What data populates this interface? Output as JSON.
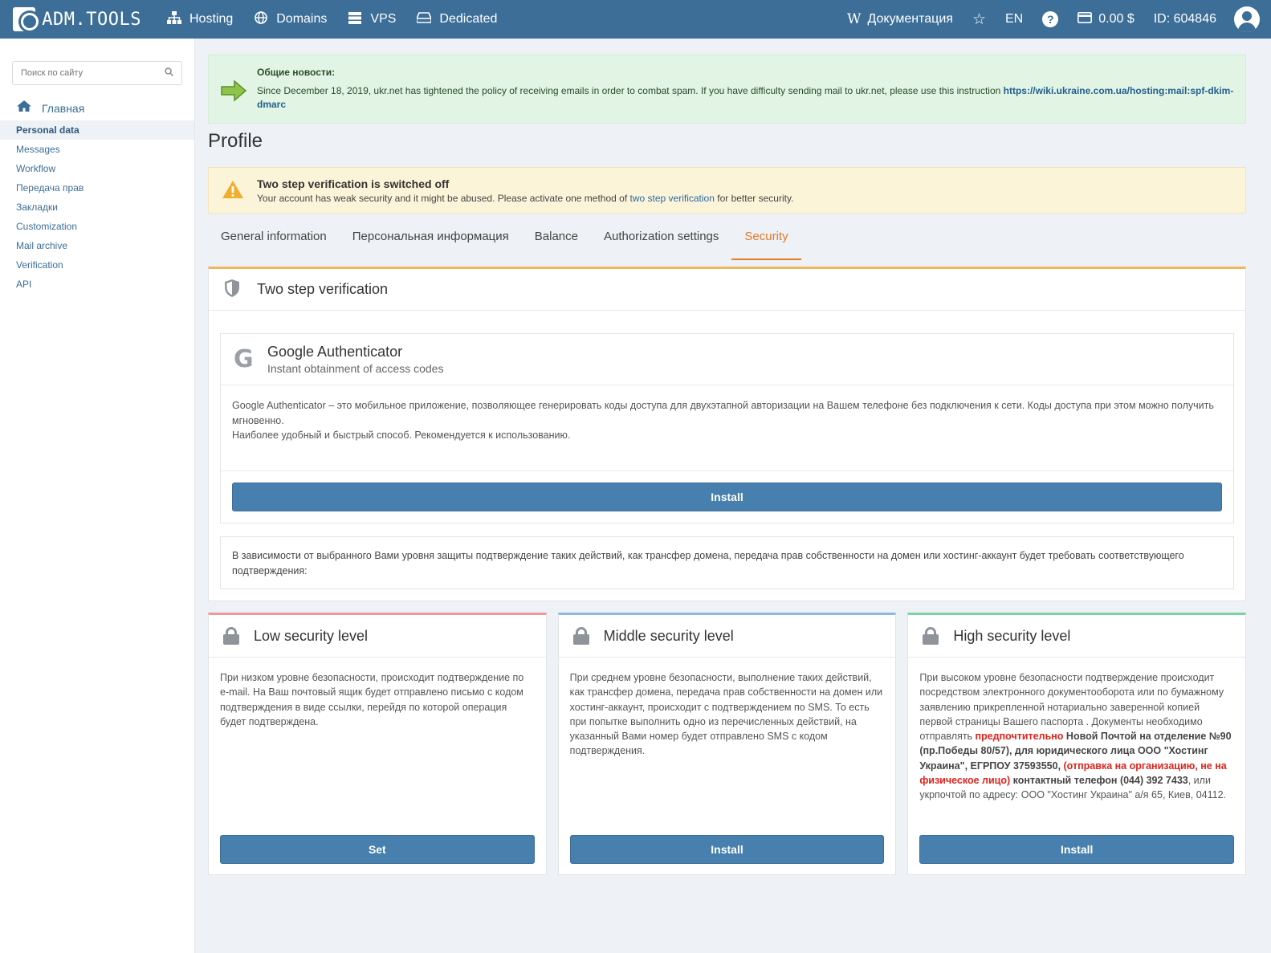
{
  "topbar": {
    "logo_text": "ADM.TOOLS",
    "nav": [
      {
        "label": "Hosting",
        "icon": "sitemap-icon"
      },
      {
        "label": "Domains",
        "icon": "globe-icon"
      },
      {
        "label": "VPS",
        "icon": "server-icon"
      },
      {
        "label": "Dedicated",
        "icon": "hdd-icon"
      }
    ],
    "docs_label": "Документация",
    "lang": "EN",
    "balance": "0.00 $",
    "account_id": "ID: 604846",
    "color_bg": "#3c6e98"
  },
  "sidebar": {
    "search_placeholder": "Поиск по сайту",
    "home_label": "Главная",
    "items": [
      {
        "label": "Personal data",
        "active": true
      },
      {
        "label": "Messages"
      },
      {
        "label": "Workflow"
      },
      {
        "label": "Передача прав"
      },
      {
        "label": "Закладки"
      },
      {
        "label": "Customization"
      },
      {
        "label": "Mail archive"
      },
      {
        "label": "Verification"
      },
      {
        "label": "API"
      }
    ]
  },
  "news": {
    "title": "Общие новости:",
    "text": "Since December 18, 2019, ukr.net has tightened the policy of receiving emails in order to combat spam. If you have difficulty sending mail to ukr.net, please use this instruction ",
    "link": "https://wiki.ukraine.com.ua/hosting:mail:spf-dkim-dmarc"
  },
  "page_title": "Profile",
  "warning": {
    "title": "Two step verification is switched off",
    "text_before": "Your account has weak security and it might be abused. Please activate one method of ",
    "link": "two step verification",
    "text_after": " for better security."
  },
  "tabs": [
    {
      "label": "General information"
    },
    {
      "label": "Персональная информация"
    },
    {
      "label": "Balance"
    },
    {
      "label": "Authorization settings"
    },
    {
      "label": "Security",
      "active": true
    }
  ],
  "two_step": {
    "title": "Two step verification",
    "ga_title": "Google Authenticator",
    "ga_subtitle": "Instant obtainment of access codes",
    "ga_desc_1": "Google Authenticator – это мобильное приложение, позволяющее генерировать коды доступа для двухэтапной авторизации на Вашем телефоне без подключения к сети. Коды доступа при этом можно получить мгновенно.",
    "ga_desc_2": "Наиболее удобный и быстрый способ. Рекомендуется к использованию.",
    "install_label": "Install",
    "dependency_text": "В зависимости от выбранного Вами уровня защиты подтверждение таких действий, как трансфер домена, передача прав собственности на домен или хостинг-аккаунт будет требовать соответствующего подтверждения:"
  },
  "levels": {
    "low": {
      "title": "Low security level",
      "text": "При низком уровне безопасности, происходит подтверждение по e-mail. На Ваш почтовый ящик будет отправлено письмо с кодом подтверждения в виде ссылки, перейдя по которой операция будет подтверждена.",
      "button": "Set"
    },
    "mid": {
      "title": "Middle security level",
      "text": "При среднем уровне безопасности, выполнение таких действий, как трансфер домена, передача прав собственности на домен или хостинг-аккаунт, происходит с подтверждением по SMS. То есть при попытке выполнить одно из перечисленных действий, на указанный Вами номер будет отправлено SMS с кодом подтверждения.",
      "button": "Install"
    },
    "high": {
      "title": "High security level",
      "text_1": "При высоком уровне безопасности подтверждение происходит посредством электронного документооборота или по бумажному заявлению прикрепленной нотариально заверенной копией первой страницы Вашего паспорта . Документы необходимо отправлять ",
      "red_1": "предпочтительно",
      "bold_1": " Новой Почтой на отделение №90 (пр.Победы 80/57), для юридического лица ООО \"Хостинг Украина\", ЕГРПОУ 37593550, ",
      "red_2": "(отправка на организацию, не на физическое лицо)",
      "bold_2": " контактный телефон (044) 392 7433",
      "text_2": ", или укрпочтой по адресу: ООО \"Хостинг Украина\" а/я 65, Киев, 04112.",
      "button": "Install"
    }
  }
}
